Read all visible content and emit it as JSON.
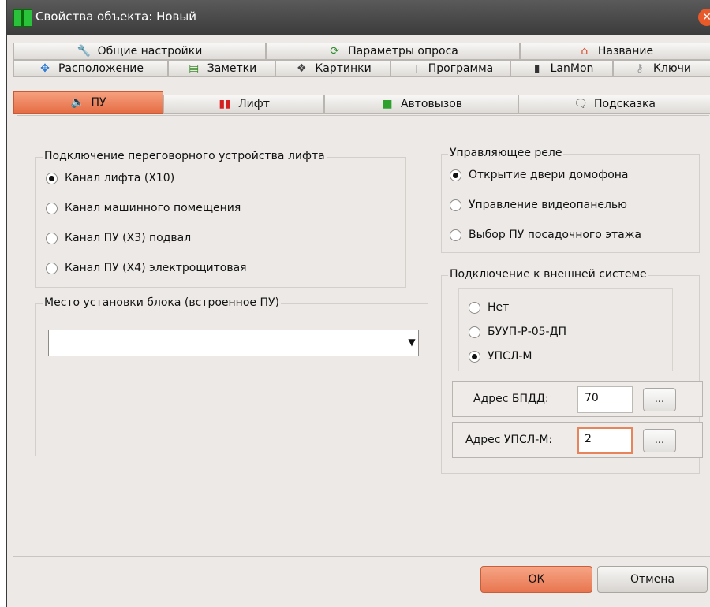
{
  "window": {
    "title": "Свойства объекта: Новый"
  },
  "tabs": {
    "row1": [
      {
        "label": "Общие настройки",
        "icon": "wrench-icon"
      },
      {
        "label": "Параметры опроса",
        "icon": "refresh-icon"
      },
      {
        "label": "Название",
        "icon": "home-icon"
      }
    ],
    "row2": [
      {
        "label": "Расположение",
        "icon": "move-icon"
      },
      {
        "label": "Заметки",
        "icon": "notes-icon"
      },
      {
        "label": "Картинки",
        "icon": "pictures-icon"
      },
      {
        "label": "Программа",
        "icon": "document-icon"
      },
      {
        "label": "LanMon",
        "icon": "device-icon"
      },
      {
        "label": "Ключи",
        "icon": "key-icon"
      }
    ],
    "row3": [
      {
        "label": "ПУ",
        "icon": "speaker-icon",
        "active": true
      },
      {
        "label": "Лифт",
        "icon": "elevator-icon"
      },
      {
        "label": "Автовызов",
        "icon": "autocall-icon"
      },
      {
        "label": "Подсказка",
        "icon": "hint-icon"
      }
    ]
  },
  "intercom": {
    "legend": "Подключение переговорного устройства лифта",
    "options": [
      {
        "label": "Канал лифта (Х10)",
        "checked": true
      },
      {
        "label": "Канал машинного помещения",
        "checked": false
      },
      {
        "label": "Канал ПУ (Х3) подвал",
        "checked": false
      },
      {
        "label": "Канал ПУ (Х4) электрощитовая",
        "checked": false
      }
    ]
  },
  "location": {
    "legend": "Место установки блока (встроенное ПУ)",
    "value": ""
  },
  "relay": {
    "legend": "Управляющее реле",
    "options": [
      {
        "label": "Открытие двери домофона",
        "checked": true
      },
      {
        "label": "Управление видеопанелью",
        "checked": false
      },
      {
        "label": "Выбор ПУ посадочного этажа",
        "checked": false
      }
    ]
  },
  "external": {
    "legend": "Подключение к внешней системе",
    "options": [
      {
        "label": "Нет",
        "checked": false
      },
      {
        "label": "БУУП-Р-05-ДП",
        "checked": false
      },
      {
        "label": "УПСЛ-М",
        "checked": true
      }
    ],
    "bpdd": {
      "label": "Адрес БПДД:",
      "value": "70",
      "button": "..."
    },
    "upsl": {
      "label": "Адрес УПСЛ-М:",
      "value": "2",
      "button": "..."
    }
  },
  "buttons": {
    "ok": "ОК",
    "cancel": "Отмена"
  },
  "colors": {
    "accent": "#e87650",
    "titlebar": "#4a4a4a",
    "background": "#ece9e6"
  }
}
